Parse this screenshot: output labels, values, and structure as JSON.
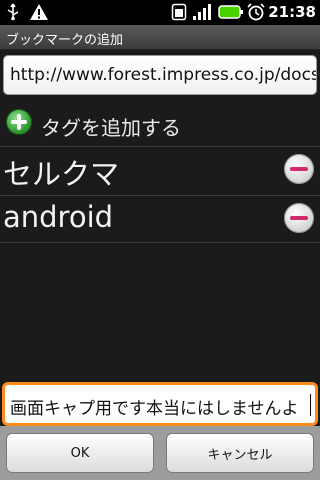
{
  "status_bar": {
    "time": "21:38",
    "icons": [
      "usb-icon",
      "warning-icon",
      "sim-icon",
      "signal-icon",
      "battery-icon",
      "alarm-icon"
    ]
  },
  "header": {
    "title": "ブックマークの追加"
  },
  "form": {
    "url_value": "http://www.forest.impress.co.jp/docs",
    "add_tag_label": "タグを追加する",
    "tags": [
      {
        "label": "セルクマ"
      },
      {
        "label": "android"
      }
    ],
    "note_value": "画面キャプ用です本当にはしませんよ"
  },
  "buttons": {
    "ok_label": "OK",
    "cancel_label": "キャンセル"
  },
  "colors": {
    "focus_border": "#ff8c1a",
    "add_icon": "#2f9a2f",
    "remove_icon": "#d02b6a"
  }
}
